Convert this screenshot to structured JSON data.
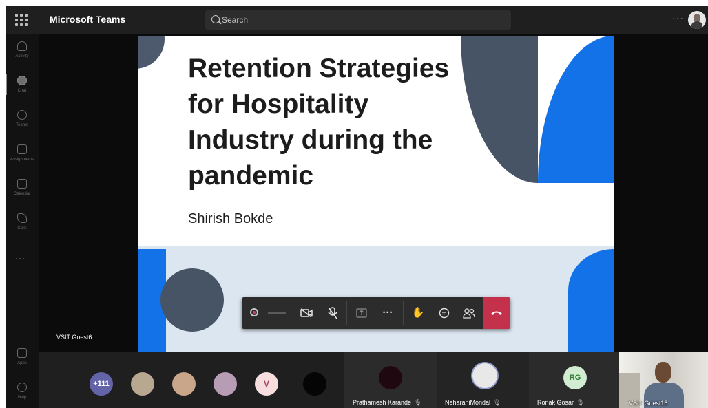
{
  "app": {
    "title": "Microsoft Teams"
  },
  "search": {
    "placeholder": "Search"
  },
  "rail": {
    "items": [
      {
        "label": "Activity",
        "icon": "bell-icon"
      },
      {
        "label": "Chat",
        "icon": "chat-icon"
      },
      {
        "label": "Teams",
        "icon": "teams-icon"
      },
      {
        "label": "Assignments",
        "icon": "assignments-icon"
      },
      {
        "label": "Calendar",
        "icon": "calendar-icon"
      },
      {
        "label": "Calls",
        "icon": "phone-icon"
      }
    ],
    "more": "···",
    "bottom": [
      {
        "label": "Apps",
        "icon": "apps-icon"
      },
      {
        "label": "Help",
        "icon": "help-icon"
      }
    ]
  },
  "slide": {
    "title": "Retention Strategies for Hospitality Industry during the pandemic",
    "author": "Shirish Bokde",
    "colors": {
      "blue": "#1472e8",
      "slate": "#465466",
      "light": "#dce6f0"
    }
  },
  "presenter": {
    "name": "VSIT Guest6"
  },
  "controls": {
    "items": [
      "recording-icon",
      "camera-off-icon",
      "mic-off-icon",
      "share-tray-icon",
      "more-options-icon",
      "raise-hand-icon",
      "chat-icon",
      "participants-icon",
      "hang-up-icon"
    ]
  },
  "participants": {
    "overflow": "+111",
    "initial_v": "V",
    "tiles": [
      {
        "name": "Prathamesh Karande"
      },
      {
        "name": "NeharaniMondal"
      },
      {
        "name": "Ronak Gosar",
        "initials": "RG"
      },
      {
        "name": "VSIT Guest16"
      }
    ]
  },
  "accent": "#6264a7",
  "hangup_color": "#c4314b"
}
